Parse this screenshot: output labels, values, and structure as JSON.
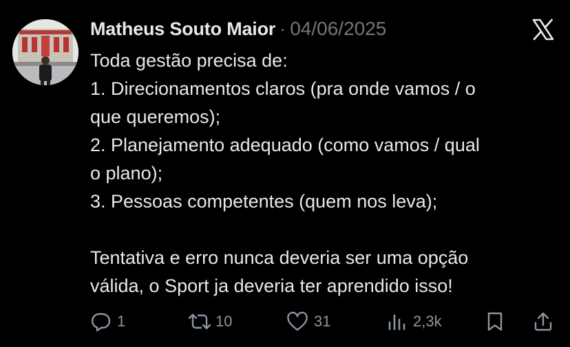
{
  "tweet": {
    "author_name": "Matheus Souto Maior",
    "separator": "·",
    "date": "04/06/2025",
    "text_lines": [
      "Toda gestão precisa de:",
      "1. Direcionamentos claros (pra onde vamos / o",
      "que queremos);",
      "2. Planejamento adequado (como vamos / qual",
      "o plano);",
      "3.  Pessoas competentes (quem nos leva);",
      "",
      "Tentativa e erro nunca deveria ser uma opção",
      "válida, o Sport ja deveria ter aprendido isso!"
    ]
  },
  "actions": {
    "replies": "1",
    "reposts": "10",
    "likes": "31",
    "views": "2,3k"
  },
  "icons": {
    "platform_logo": "x-logo-icon",
    "reply": "reply-icon",
    "repost": "repost-icon",
    "like": "heart-icon",
    "views": "views-icon",
    "bookmark": "bookmark-icon",
    "share": "share-icon"
  },
  "colors": {
    "background": "#000000",
    "text": "#e7e9ea",
    "secondary_text": "#71767b",
    "icon": "#8b98a5"
  }
}
